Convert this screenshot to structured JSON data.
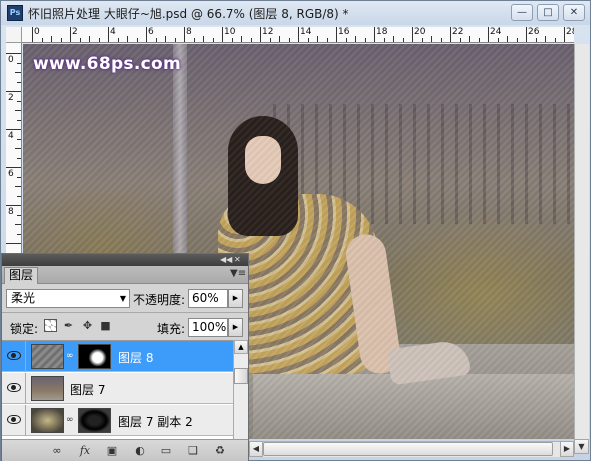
{
  "window": {
    "title": "怀旧照片处理 大眼仔~旭.psd @ 66.7% (图层 8, RGB/8) *",
    "app_icon": "Ps",
    "minimize_icon": "minimize-icon",
    "maximize_icon": "maximize-icon",
    "close_icon": "close-icon"
  },
  "rulers": {
    "top_labels": [
      "0",
      "2",
      "4",
      "6",
      "8",
      "10",
      "12",
      "14",
      "16",
      "18",
      "20",
      "22",
      "24",
      "26",
      "28"
    ],
    "left_labels": [
      "0",
      "2",
      "4",
      "6",
      "8"
    ]
  },
  "canvas": {
    "watermark": "www.68ps.com"
  },
  "layers_panel": {
    "tab_label": "图层",
    "blend_mode": "柔光",
    "opacity_label": "不透明度:",
    "opacity_value": "60%",
    "lock_label": "锁定:",
    "fill_label": "填充:",
    "fill_value": "100%",
    "layers": [
      {
        "name": "图层 8",
        "selected": true,
        "has_mask": true
      },
      {
        "name": "图层 7",
        "selected": false,
        "has_mask": false
      },
      {
        "name": "图层 7 副本 2",
        "selected": false,
        "has_mask": true
      }
    ]
  },
  "colors": {
    "selection": "#3d9bfa",
    "watermark_glow": "#5a2a8a"
  }
}
